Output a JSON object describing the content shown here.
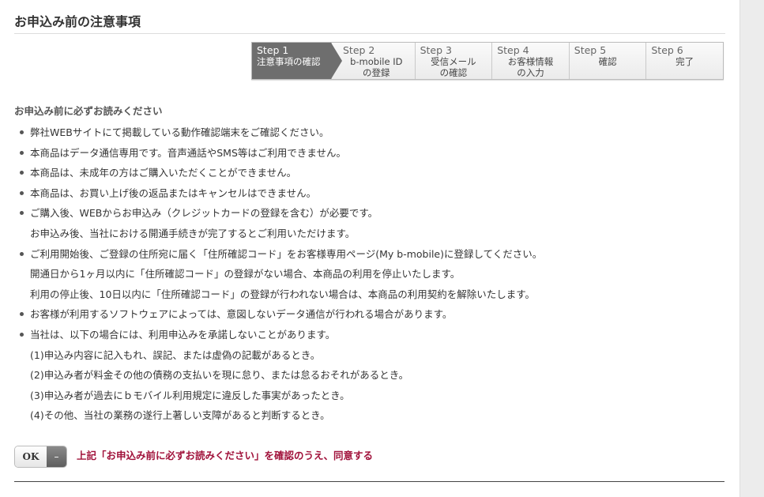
{
  "page": {
    "title": "お申込み前の注意事項"
  },
  "steps": [
    {
      "label": "Step 1",
      "desc": "注意事項の確認",
      "active": true
    },
    {
      "label": "Step 2",
      "desc": "b-mobile ID\nの登録",
      "active": false
    },
    {
      "label": "Step 3",
      "desc": "受信メール\nの確認",
      "active": false
    },
    {
      "label": "Step 4",
      "desc": "お客様情報\nの入力",
      "active": false
    },
    {
      "label": "Step 5",
      "desc": "確認",
      "active": false
    },
    {
      "label": "Step 6",
      "desc": "完了",
      "active": false
    }
  ],
  "notice": {
    "heading": "お申込み前に必ずお読みください",
    "items": [
      {
        "text": "弊社WEBサイトにて掲載している動作確認端末をご確認ください。",
        "bullet": true
      },
      {
        "text": "本商品はデータ通信専用です。音声通話やSMS等はご利用できません。",
        "bullet": true
      },
      {
        "text": "本商品は、未成年の方はご購入いただくことができません。",
        "bullet": true
      },
      {
        "text": "本商品は、お買い上げ後の返品またはキャンセルはできません。",
        "bullet": true
      },
      {
        "text": "ご購入後、WEBからお申込み（クレジットカードの登録を含む）が必要です。",
        "bullet": true
      },
      {
        "text": "お申込み後、当社における開通手続きが完了するとご利用いただけます。",
        "bullet": false
      },
      {
        "text": "ご利用開始後、ご登録の住所宛に届く「住所確認コード」をお客様専用ページ(My b-mobile)に登録してください。",
        "bullet": true
      },
      {
        "text": "開通日から1ヶ月以内に「住所確認コード」の登録がない場合、本商品の利用を停止いたします。",
        "bullet": false
      },
      {
        "text": "利用の停止後、10日以内に「住所確認コード」の登録が行われない場合は、本商品の利用契約を解除いたします。",
        "bullet": false
      },
      {
        "text": "お客様が利用するソフトウェアによっては、意図しないデータ通信が行われる場合があります。",
        "bullet": true
      },
      {
        "text": "当社は、以下の場合には、利用申込みを承諾しないことがあります。",
        "bullet": true
      },
      {
        "text": "(1)申込み内容に記入もれ、誤記、または虚偽の記載があるとき。",
        "bullet": false
      },
      {
        "text": "(2)申込み者が料金その他の債務の支払いを現に怠り、または怠るおそれがあるとき。",
        "bullet": false
      },
      {
        "text": "(3)申込み者が過去にｂモバイル利用規定に違反した事実があったとき。",
        "bullet": false
      },
      {
        "text": "(4)その他、当社の業務の遂行上著しい支障があると判断するとき。",
        "bullet": false
      }
    ]
  },
  "agreement": {
    "toggle_label": "OK",
    "toggle_knob": "–",
    "text": "上記「お申込み前に必ずお読みください」を確認のうえ、同意する",
    "text_color": "#a0113a"
  },
  "colors": {
    "active_step": "#6e6e6e",
    "scrollbar_track": "#ececec"
  }
}
